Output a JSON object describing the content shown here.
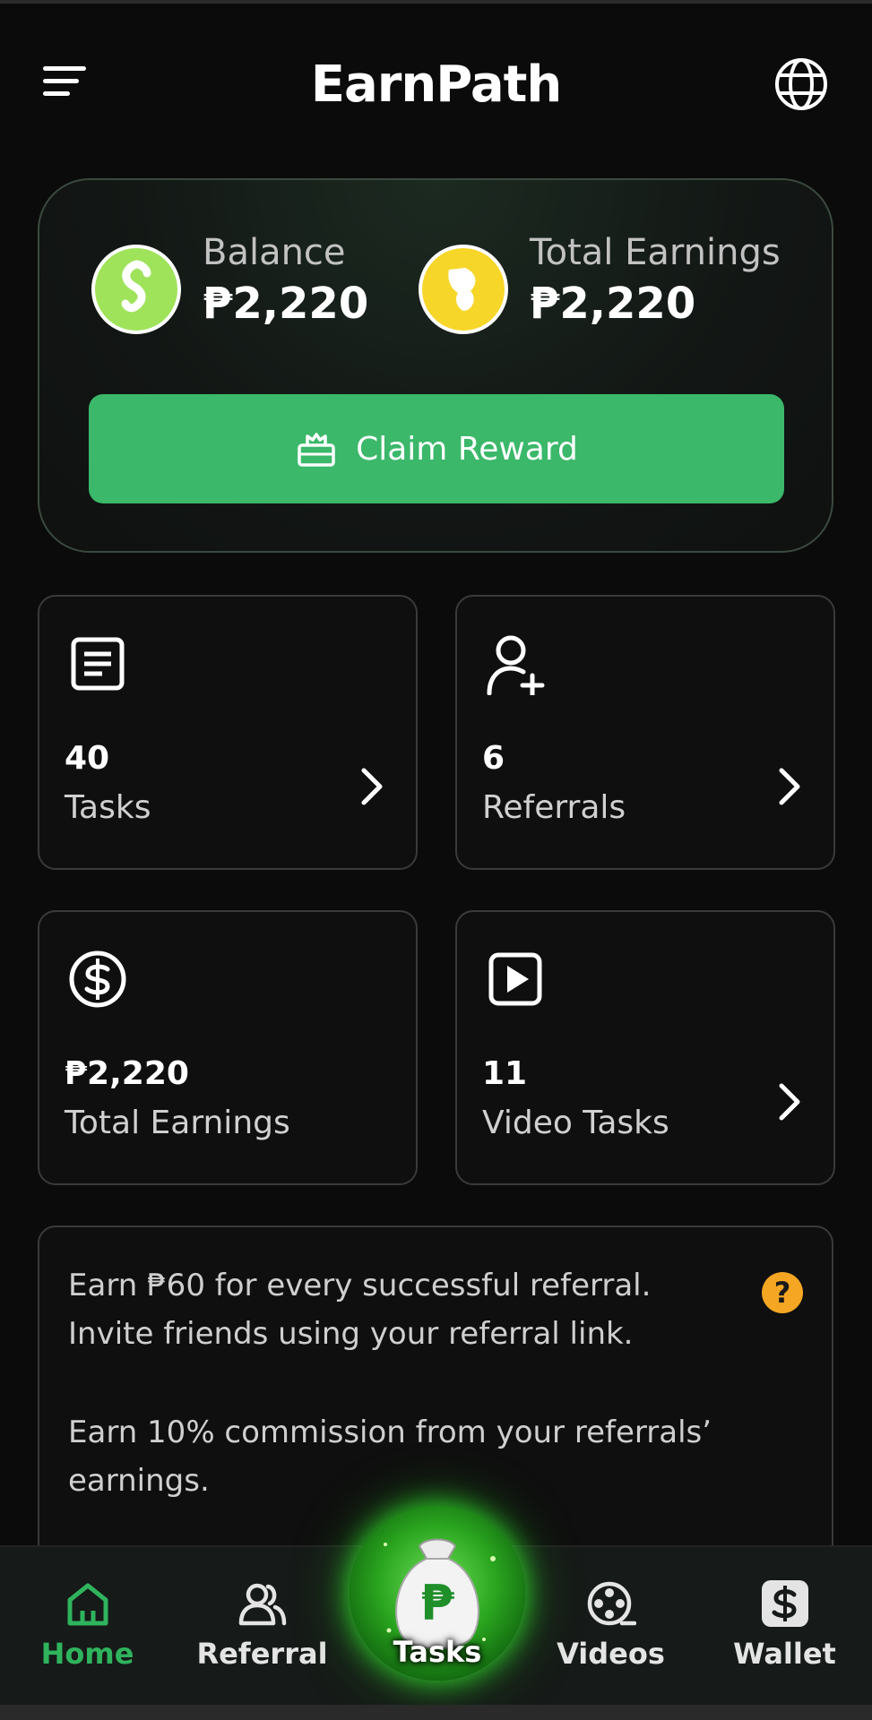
{
  "header": {
    "title": "EarnPath",
    "menu_icon": "hamburger-icon",
    "language_icon": "globe-icon"
  },
  "balance_card": {
    "balance_label": "Balance",
    "balance_value": "₱2,220",
    "total_earnings_label": "Total Earnings",
    "total_earnings_value": "₱2,220",
    "claim_button_label": "Claim Reward",
    "claim_icon": "gift-icon",
    "accent_color": "#3bb86a"
  },
  "tiles": [
    {
      "value": "40",
      "label": "Tasks",
      "icon": "document-icon",
      "has_chevron": true
    },
    {
      "value": "6",
      "label": "Referrals",
      "icon": "add-user-icon",
      "has_chevron": true
    },
    {
      "value": "₱2,220",
      "label": "Total Earnings",
      "icon": "dollar-circle-icon",
      "has_chevron": false
    },
    {
      "value": "11",
      "label": "Video Tasks",
      "icon": "play-icon",
      "has_chevron": true
    }
  ],
  "info": {
    "line1": "Earn ₱60 for every successful referral.",
    "line2": "Invite friends using your referral link.",
    "line3": "Earn 10% commission from your referrals’",
    "line4": "earnings.",
    "help_glyph": "?"
  },
  "bottom_nav": {
    "items": [
      {
        "label": "Home",
        "icon": "home-icon",
        "active": true
      },
      {
        "label": "Referral",
        "icon": "users-icon",
        "active": false
      },
      {
        "label": "Tasks",
        "icon": "money-bag-icon",
        "active": false
      },
      {
        "label": "Videos",
        "icon": "film-reel-icon",
        "active": false
      },
      {
        "label": "Wallet",
        "icon": "wallet-dollar-icon",
        "active": false
      }
    ],
    "active_color": "#2fb35d"
  }
}
